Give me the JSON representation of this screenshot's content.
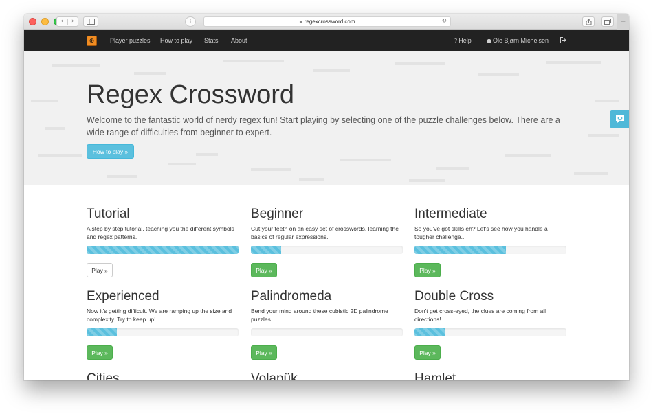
{
  "browser": {
    "url": "regexcrossword.com",
    "back_glyph": "‹",
    "forward_glyph": "›",
    "reader_glyph": "i",
    "reload_glyph": "↻",
    "newtab_glyph": "+"
  },
  "navbar": {
    "links": [
      "Player puzzles",
      "How to play",
      "Stats",
      "About"
    ],
    "help": "Help",
    "user": "Ole Bjørn Michelsen",
    "logo_glyph": "⊕"
  },
  "hero": {
    "title": "Regex Crossword",
    "lead": "Welcome to the fantastic world of nerdy regex fun! Start playing by selecting one of the puzzle challenges below. There are a wide range of difficulties from beginner to expert.",
    "button": "How to play »"
  },
  "puzzles": [
    {
      "title": "Tutorial",
      "description": "A step by step tutorial, teaching you the different symbols and regex patterns.",
      "progress": 1.0,
      "button": "Play »",
      "style": "default"
    },
    {
      "title": "Beginner",
      "description": "Cut your teeth on an easy set of crosswords, learning the basics of regular expressions.",
      "progress": 0.2,
      "button": "Play »",
      "style": "success"
    },
    {
      "title": "Intermediate",
      "description": "So you've got skills eh? Let's see how you handle a tougher challenge...",
      "progress": 0.6,
      "button": "Play »",
      "style": "success"
    },
    {
      "title": "Experienced",
      "description": "Now it's getting difficult. We are ramping up the size and complexity. Try to keep up!",
      "progress": 0.2,
      "button": "Play »",
      "style": "success"
    },
    {
      "title": "Palindromeda",
      "description": "Bend your mind around these cubistic 2D palindrome puzzles.",
      "progress": 0.0,
      "button": "Play »",
      "style": "success"
    },
    {
      "title": "Double Cross",
      "description": "Don't get cross-eyed, the clues are coming from all directions!",
      "progress": 0.2,
      "button": "Play »",
      "style": "success"
    },
    {
      "title": "Cities",
      "description": "",
      "progress": null,
      "button": "",
      "style": "success"
    },
    {
      "title": "Volapük",
      "description": "",
      "progress": null,
      "button": "",
      "style": "success"
    },
    {
      "title": "Hamlet",
      "description": "",
      "progress": null,
      "button": "",
      "style": "success"
    }
  ],
  "colors": {
    "navbar_bg": "#222222",
    "info": "#5bc0de",
    "success": "#5cb85c",
    "logo": "#f08c22"
  },
  "icons": {
    "help": "question-circle-icon",
    "user": "facebook-icon",
    "logout": "sign-out-icon",
    "feedback": "chat-icon",
    "sidebar": "sidebar-icon",
    "share": "share-icon",
    "tabs": "tabs-icon",
    "lock": "lock-icon"
  }
}
